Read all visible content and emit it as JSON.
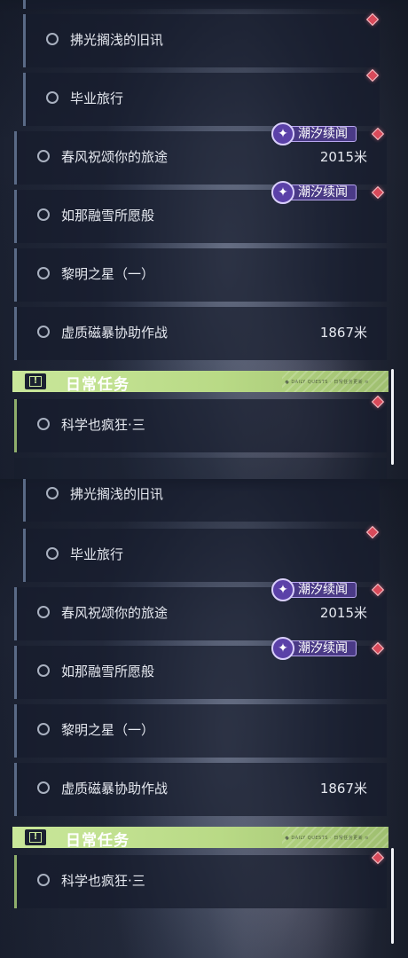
{
  "quests": [
    {
      "name": "拂光搁浅的旧讯"
    },
    {
      "name": "毕业旅行"
    },
    {
      "name": "春风祝颂你的旅途",
      "distance": "2015米",
      "badge": "潮汐续闻"
    },
    {
      "name": "如那融雪所愿般",
      "badge": "潮汐续闻"
    },
    {
      "name": "黎明之星（一）"
    },
    {
      "name": "虚质磁暴协助作战",
      "distance": "1867米"
    }
  ],
  "daily": {
    "title": "日常任务",
    "tag": "● DAILY QUESTS · 日常任务更新 ≡",
    "items": [
      {
        "name": "科学也疯狂·三"
      }
    ]
  },
  "icons": {
    "quest_status": "circle-icon",
    "tracked": "diamond-marker-icon",
    "badge": "tide-badge-icon",
    "daily": "exclamation-box-icon"
  },
  "colors": {
    "accent_green": "#c9e79a",
    "badge_purple": "#4a3a86",
    "marker_red": "#d94a5a"
  }
}
